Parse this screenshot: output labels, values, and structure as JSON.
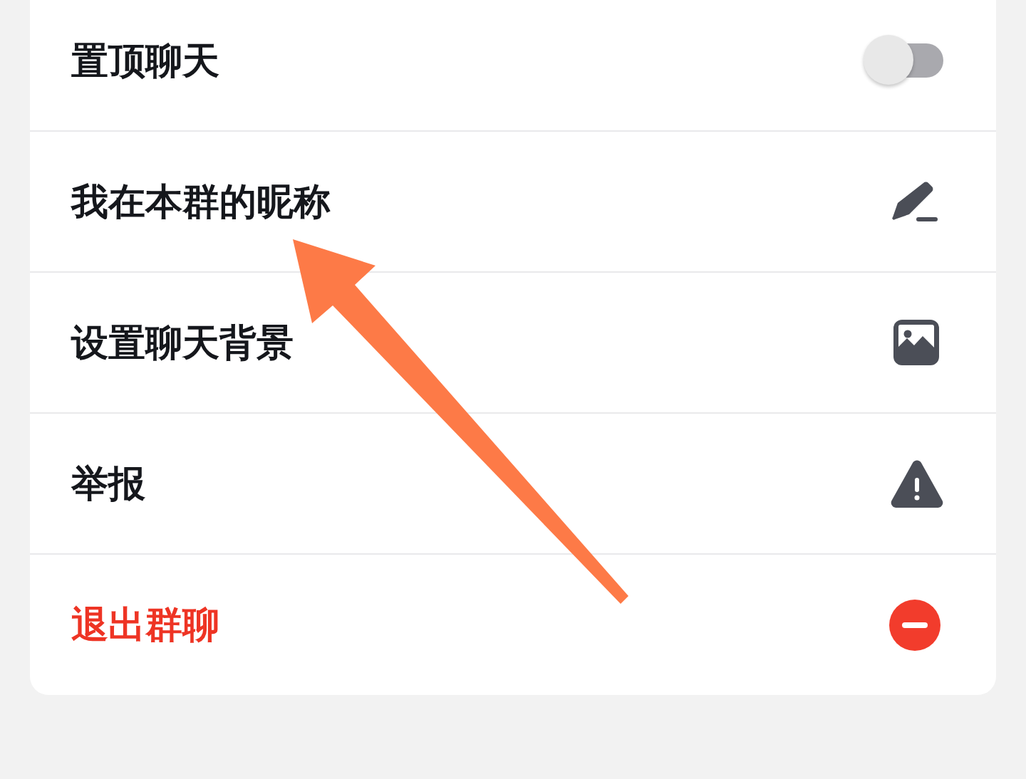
{
  "rows": [
    {
      "label": "置顶聊天",
      "kind": "toggle",
      "on": false,
      "danger": false
    },
    {
      "label": "我在本群的昵称",
      "kind": "pencil",
      "danger": false
    },
    {
      "label": "设置聊天背景",
      "kind": "picture",
      "danger": false
    },
    {
      "label": "举报",
      "kind": "warning",
      "danger": false
    },
    {
      "label": "退出群聊",
      "kind": "leave",
      "danger": true
    }
  ]
}
